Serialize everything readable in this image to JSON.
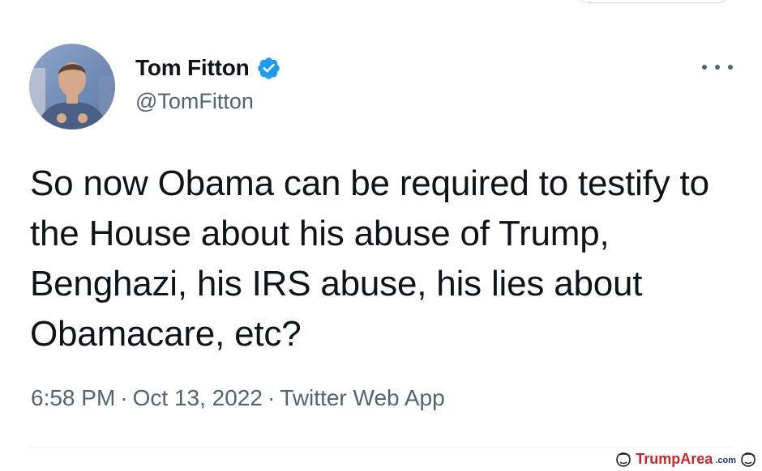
{
  "tweet": {
    "display_name": "Tom Fitton",
    "handle": "@TomFitton",
    "verified": true,
    "verified_color": "#1d9bf0",
    "text": "So now Obama can be required to testify to the House about his abuse of Trump, Benghazi, his IRS abuse, his lies about Obamacare, etc?",
    "time": "6:58 PM",
    "date": "Oct 13, 2022",
    "source": "Twitter Web App",
    "separator": "·",
    "more_icon": "more-horizontal-icon"
  },
  "watermark": {
    "brand": "TrumpArea",
    "suffix": ".com",
    "brand_color": "#c8272d"
  }
}
